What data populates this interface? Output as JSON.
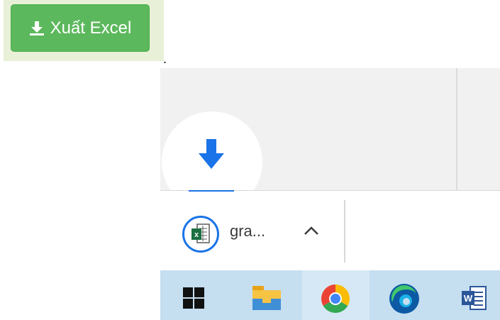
{
  "export_button": {
    "label": "Xuất Excel",
    "icon": "download-icon"
  },
  "separator_dot": ".",
  "download_bar": {
    "indicator_icon": "download-arrow-icon",
    "item": {
      "file_name": "gra...",
      "icon": "excel-file-icon",
      "menu_icon": "chevron-up-icon"
    }
  },
  "taskbar": {
    "apps": [
      {
        "name": "windows-start",
        "icon": "windows-logo-icon"
      },
      {
        "name": "file-explorer",
        "icon": "folder-icon"
      },
      {
        "name": "chrome",
        "icon": "chrome-icon"
      },
      {
        "name": "edge",
        "icon": "edge-icon"
      },
      {
        "name": "word",
        "icon": "word-icon"
      }
    ]
  },
  "colors": {
    "button_green": "#5cb85c",
    "accent_blue": "#1a73e8",
    "taskbar": "#c5def0",
    "excel_green": "#1d6f42",
    "word_blue": "#2b579a"
  }
}
